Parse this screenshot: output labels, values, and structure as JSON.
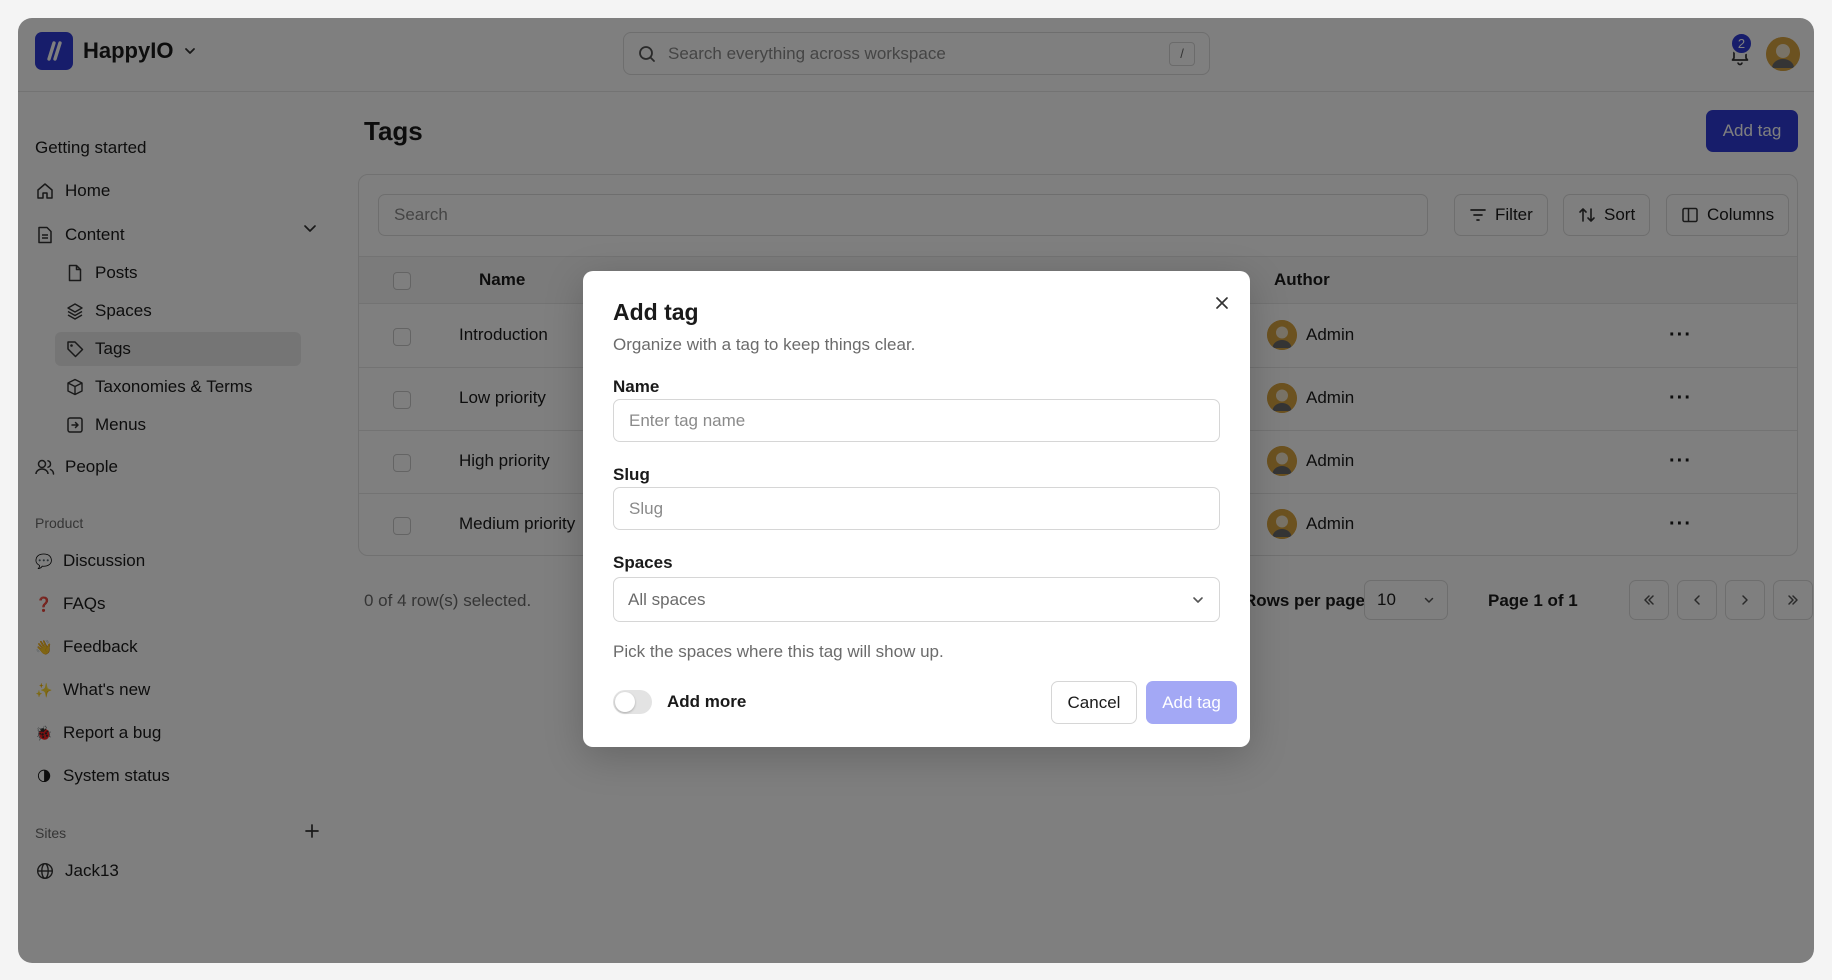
{
  "brand": {
    "name": "HappyIO",
    "logo_glyph": "//"
  },
  "search": {
    "placeholder": "Search everything across workspace",
    "shortcut": "/"
  },
  "notifications": {
    "count": "2"
  },
  "sidebar": {
    "heading": "Getting started",
    "home": "Home",
    "content": "Content",
    "content_items": [
      {
        "label": "Posts",
        "icon": "file-icon"
      },
      {
        "label": "Spaces",
        "icon": "layers-icon"
      },
      {
        "label": "Tags",
        "icon": "tag-icon",
        "active": true
      },
      {
        "label": "Taxonomies & Terms",
        "icon": "cube-icon"
      },
      {
        "label": "Menus",
        "icon": "menu-box-icon"
      }
    ],
    "people": "People",
    "product_section": "Product",
    "product_items": [
      {
        "label": "Discussion",
        "emoji": "💬"
      },
      {
        "label": "FAQs",
        "emoji": "❓"
      },
      {
        "label": "Feedback",
        "emoji": "👋"
      },
      {
        "label": "What's new",
        "emoji": "✨"
      },
      {
        "label": "Report a bug",
        "emoji": "🐞"
      },
      {
        "label": "System status",
        "emoji": "🌗"
      }
    ],
    "sites_section": "Sites",
    "sites": [
      {
        "label": "Jack13",
        "icon": "globe-icon"
      }
    ]
  },
  "main": {
    "title": "Tags",
    "add_button": "Add tag",
    "table_search_placeholder": "Search",
    "filter": "Filter",
    "sort": "Sort",
    "columns": "Columns",
    "headers": {
      "name": "Name",
      "author": "Author"
    },
    "rows": [
      {
        "name": "Introduction",
        "author": "Admin"
      },
      {
        "name": "Low priority",
        "author": "Admin"
      },
      {
        "name": "High priority",
        "author": "Admin"
      },
      {
        "name": "Medium priority",
        "author": "Admin"
      }
    ],
    "selection": "0 of 4 row(s) selected.",
    "rows_per_page_label": "Rows per page",
    "rows_per_page": "10",
    "page_of": "Page 1 of 1"
  },
  "modal": {
    "title": "Add tag",
    "subtitle": "Organize with a tag to keep things clear.",
    "name_label": "Name",
    "name_placeholder": "Enter tag name",
    "slug_label": "Slug",
    "slug_placeholder": "Slug",
    "spaces_label": "Spaces",
    "spaces_value": "All spaces",
    "spaces_help": "Pick the spaces where this tag will show up.",
    "add_more_label": "Add more",
    "add_more_on": false,
    "cancel": "Cancel",
    "submit": "Add tag"
  },
  "colors": {
    "accent": "#2f3bd6",
    "accent_disabled": "#a3a8f5",
    "overlay": "rgba(0,0,0,0.5)"
  }
}
